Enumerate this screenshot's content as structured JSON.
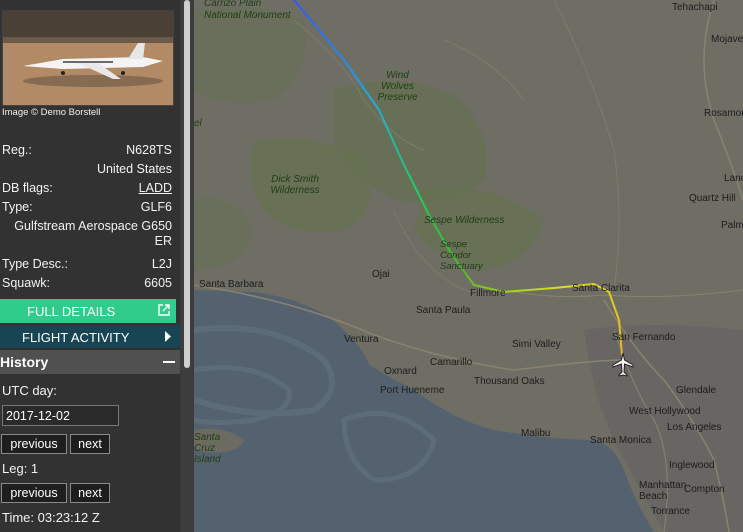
{
  "sidebar": {
    "photo_credit": "Image © Demo Borstell",
    "reg_label": "Reg.:",
    "reg_value": "N628TS",
    "country": "United States",
    "db_flags_label": "DB flags:",
    "db_flags_value": "LADD",
    "type_label": "Type:",
    "type_value": "GLF6",
    "type_full": "Gulfstream Aerospace G650 ER",
    "type_desc_label": "Type Desc.:",
    "type_desc_value": "L2J",
    "squawk_label": "Squawk:",
    "squawk_value": "6605",
    "full_details_label": "FULL DETAILS",
    "flight_activity_label": "FLIGHT ACTIVITY"
  },
  "history": {
    "title": "History",
    "utc_day_label": "UTC day:",
    "utc_day_value": "2017-12-02",
    "previous_label": "previous",
    "next_label": "next",
    "leg_label": "Leg: 1",
    "time_label": "Time: 03:23:12 Z"
  },
  "map": {
    "places": {
      "tehachapi": "Tehachapi",
      "mojave": "Mojave",
      "carrizo": "Carrizo Plain National Monument",
      "wind_wolves": "Wind Wolves Preserve",
      "rosamond": "Rosamond",
      "lancaster": "Lanca",
      "quartz_hill": "Quartz Hill",
      "palmdale": "Palm",
      "dick_smith": "Dick Smith Wilderness",
      "sespe": "Sespe Wilderness",
      "sespe_condor": "Sespe Condor Sanctuary",
      "ojai": "Ojai",
      "santa_barbara": "Santa Barbara",
      "fillmore": "Fillmore",
      "santa_clarita": "Santa Clarita",
      "santa_paula": "Santa Paula",
      "san_fernando": "San Fernando",
      "ventura": "Ventura",
      "simi_valley": "Simi Valley",
      "oxnard": "Oxnard",
      "camarillo": "Camarillo",
      "thousand_oaks": "Thousand Oaks",
      "port_hueneme": "Port Hueneme",
      "glendale": "Glendale",
      "west_hollywood": "West Hollywood",
      "los_angeles": "Los Angeles",
      "santa_cruz_island": "Santa Cruz Island",
      "malibu": "Malibu",
      "santa_monica": "Santa Monica",
      "inglewood": "Inglewood",
      "manhattan_beach": "Manhattan Beach",
      "compton": "Compton",
      "torrance": "Torrance",
      "edge_partial": "el"
    },
    "track_colors": [
      "#3355ff",
      "#22aadd",
      "#22cc66",
      "#44bb22",
      "#dddd22",
      "#eeaa22"
    ]
  }
}
